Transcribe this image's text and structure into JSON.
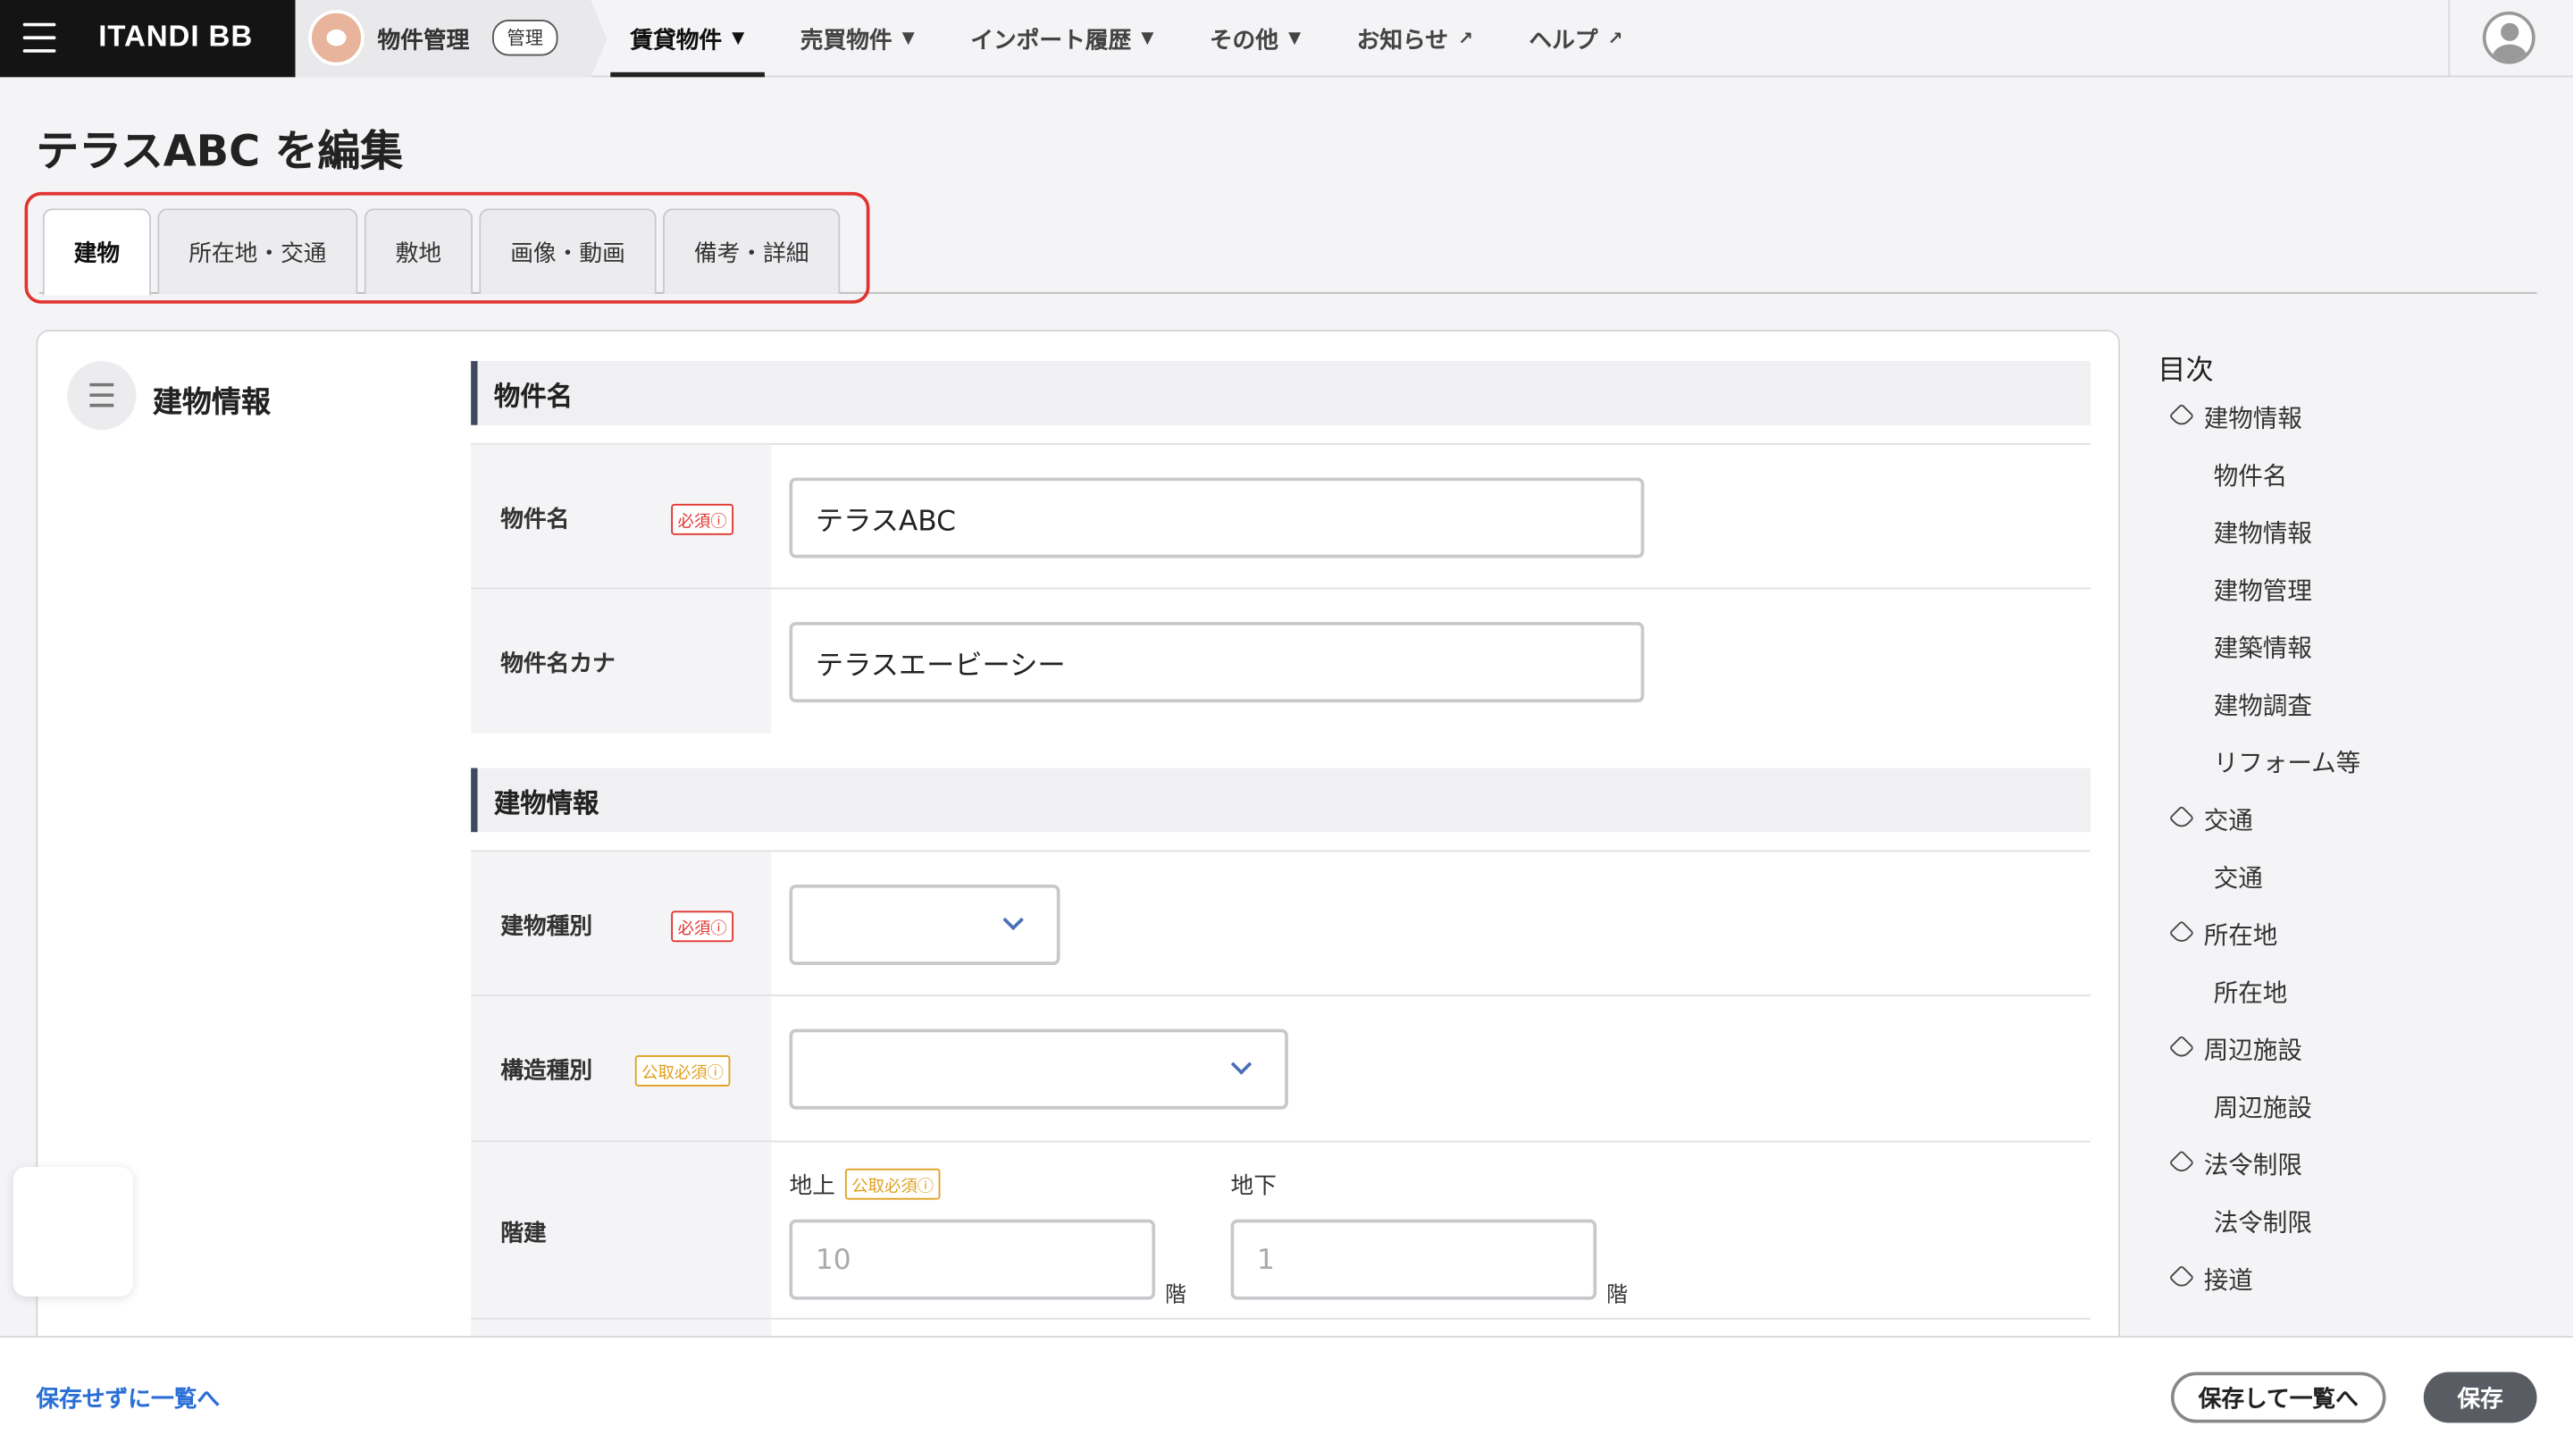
{
  "header": {
    "logo": "ITANDI BB",
    "product_name": "物件管理",
    "product_badge": "管理",
    "nav": [
      {
        "label": "賃貸物件",
        "active": true
      },
      {
        "label": "売買物件"
      },
      {
        "label": "インポート履歴"
      },
      {
        "label": "その他"
      },
      {
        "label": "お知らせ"
      },
      {
        "label": "ヘルプ"
      }
    ]
  },
  "page": {
    "title": "テラスABC を編集"
  },
  "tabs": [
    "建物",
    "所在地・交通",
    "敷地",
    "画像・動画",
    "備考・詳細"
  ],
  "section": {
    "title": "建物情報"
  },
  "groups": {
    "property_name": "物件名",
    "building_info": "建物情報"
  },
  "fields": {
    "name_label": "物件名",
    "name_value": "テラスABC",
    "kana_label": "物件名カナ",
    "kana_value": "テラスエービーシー",
    "building_type_label": "建物種別",
    "structure_type_label": "構造種別",
    "floors_label": "階建",
    "above_label": "地上",
    "above_placeholder": "10",
    "below_label": "地下",
    "below_placeholder": "1",
    "floor_unit": "階"
  },
  "badges": {
    "required": "必須",
    "public_required": "公取必須"
  },
  "toc": {
    "title": "目次",
    "items": [
      {
        "label": "建物情報",
        "level": 1
      },
      {
        "label": "物件名",
        "level": 2
      },
      {
        "label": "建物情報",
        "level": 2
      },
      {
        "label": "建物管理",
        "level": 2
      },
      {
        "label": "建築情報",
        "level": 2
      },
      {
        "label": "建物調査",
        "level": 2
      },
      {
        "label": "リフォーム等",
        "level": 2
      },
      {
        "label": "交通",
        "level": 1
      },
      {
        "label": "交通",
        "level": 2
      },
      {
        "label": "所在地",
        "level": 1
      },
      {
        "label": "所在地",
        "level": 2
      },
      {
        "label": "周辺施設",
        "level": 1
      },
      {
        "label": "周辺施設",
        "level": 2
      },
      {
        "label": "法令制限",
        "level": 1
      },
      {
        "label": "法令制限",
        "level": 2
      },
      {
        "label": "接道",
        "level": 1
      }
    ]
  },
  "footer": {
    "back_link": "保存せずに一覧へ",
    "save_and_list": "保存して一覧へ",
    "save": "保存"
  },
  "colors": {
    "accent_red": "#e0342f",
    "link_blue": "#2a6fd6",
    "badge_orange": "#e0a020",
    "dark_button": "#595c63"
  }
}
